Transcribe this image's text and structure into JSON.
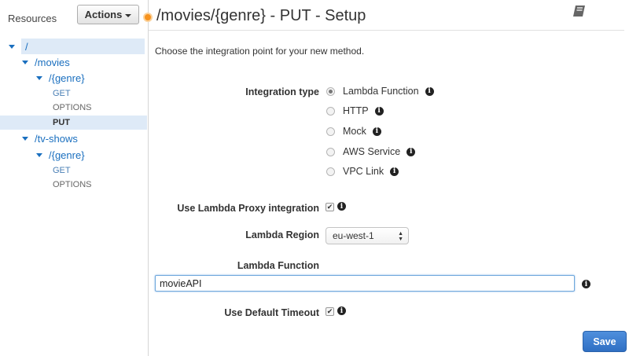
{
  "sidebar": {
    "resources_label": "Resources",
    "actions_label": "Actions",
    "tree": [
      {
        "label": "/",
        "kind": "resource"
      },
      {
        "label": "/movies",
        "kind": "resource"
      },
      {
        "label": "/{genre}",
        "kind": "resource"
      },
      {
        "label": "GET",
        "kind": "method"
      },
      {
        "label": "OPTIONS",
        "kind": "method"
      },
      {
        "label": "PUT",
        "kind": "method",
        "selected": true
      },
      {
        "label": "/tv-shows",
        "kind": "resource"
      },
      {
        "label": "/{genre}",
        "kind": "resource"
      },
      {
        "label": "GET",
        "kind": "method"
      },
      {
        "label": "OPTIONS",
        "kind": "method"
      }
    ]
  },
  "main": {
    "title": "/movies/{genre} - PUT - Setup",
    "intro": "Choose the integration point for your new method.",
    "integration_type_label": "Integration type",
    "integration_options": [
      {
        "label": "Lambda Function",
        "checked": true
      },
      {
        "label": "HTTP",
        "checked": false
      },
      {
        "label": "Mock",
        "checked": false
      },
      {
        "label": "AWS Service",
        "checked": false
      },
      {
        "label": "VPC Link",
        "checked": false
      }
    ],
    "proxy_label": "Use Lambda Proxy integration",
    "proxy_checked": true,
    "region_label": "Lambda Region",
    "region_value": "eu-west-1",
    "function_label": "Lambda Function",
    "function_value": "movieAPI",
    "timeout_label": "Use Default Timeout",
    "timeout_checked": true,
    "save_label": "Save"
  },
  "colors": {
    "accent": "#1a6fbf",
    "selected_bg": "#deeaf7",
    "save_button": "#3a7bd5",
    "status_dot": "#f7931e"
  },
  "icons": {
    "info": "info-icon",
    "notebook": "notebook-icon",
    "checkmark": "✔"
  }
}
